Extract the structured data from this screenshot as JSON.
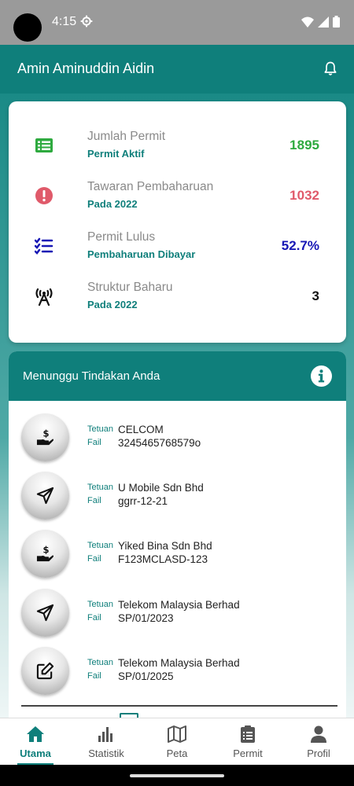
{
  "status_bar": {
    "time": "4:15"
  },
  "header": {
    "title": "Amin Aminuddin Aidin"
  },
  "stats": [
    {
      "icon": "list-icon",
      "title": "Jumlah Permit",
      "subtitle": "Permit Aktif",
      "value": "1895",
      "color": "#2eaa3f"
    },
    {
      "icon": "alert-icon",
      "title": "Tawaran Pembaharuan",
      "subtitle": "Pada 2022",
      "value": "1032",
      "color": "#e05a6a"
    },
    {
      "icon": "checklist-icon",
      "title": "Permit Lulus",
      "subtitle": "Pembaharuan Dibayar",
      "value": "52.7%",
      "color": "#1717b5"
    },
    {
      "icon": "tower-icon",
      "title": "Struktur Baharu",
      "subtitle": "Pada 2022",
      "value": "3",
      "color": "#111111"
    }
  ],
  "pending": {
    "title": "Menunggu Tindakan Anda",
    "owner_label": "Tetuan",
    "file_label": "Fail",
    "items": [
      {
        "icon": "money-hand-icon",
        "owner": "CELCOM",
        "file": "3245465768579o"
      },
      {
        "icon": "send-icon",
        "owner": "U Mobile Sdn Bhd",
        "file": "ggrr-12-21"
      },
      {
        "icon": "money-hand-icon",
        "owner": "Yiked Bina Sdn Bhd",
        "file": "F123MCLASD-123"
      },
      {
        "icon": "send-icon",
        "owner": "Telekom Malaysia Berhad",
        "file": "SP/01/2023"
      },
      {
        "icon": "edit-icon",
        "owner": "Telekom Malaysia Berhad",
        "file": "SP/01/2025"
      }
    ]
  },
  "nav": [
    {
      "label": "Utama",
      "icon": "home-icon",
      "active": true
    },
    {
      "label": "Statistik",
      "icon": "bar-chart-icon",
      "active": false
    },
    {
      "label": "Peta",
      "icon": "map-icon",
      "active": false
    },
    {
      "label": "Permit",
      "icon": "clipboard-icon",
      "active": false
    },
    {
      "label": "Profil",
      "icon": "person-icon",
      "active": false
    }
  ],
  "colors": {
    "brand": "#0f7f7b"
  }
}
